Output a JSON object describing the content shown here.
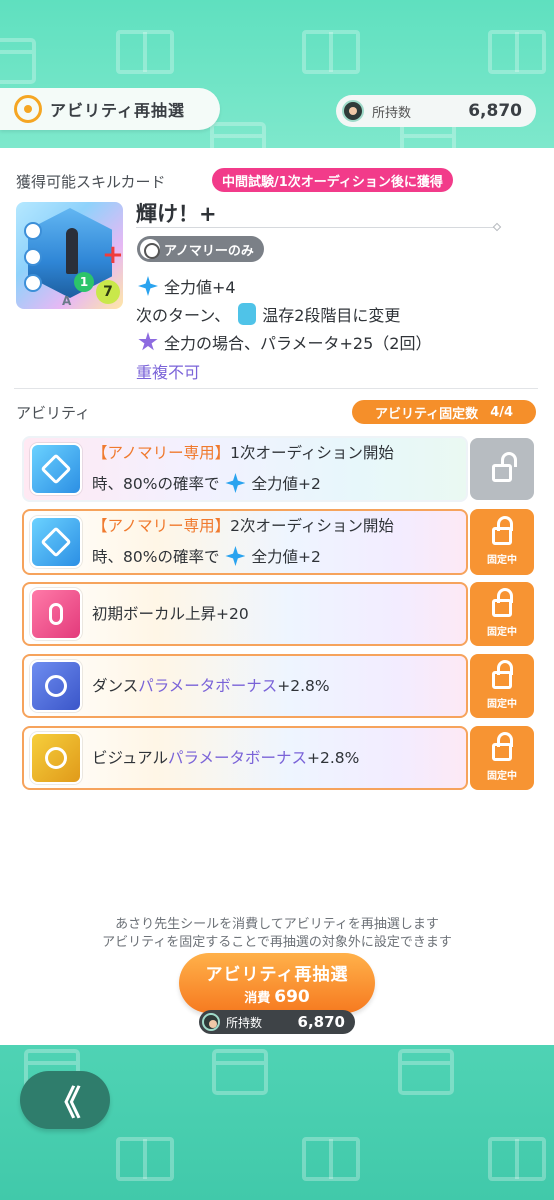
{
  "header": {
    "reroll_tab_label": "アビリティ再抽選",
    "owned_label": "所持数",
    "owned_value": "6,870"
  },
  "skill_card": {
    "section_label": "獲得可能スキルカード",
    "acquire_badge": "中間試験/1次オーディション後に獲得",
    "card_number": "1",
    "card_cost": "7",
    "card_bottom_letter": "A",
    "name": "輝け！+",
    "tag": "アノマリーのみ",
    "effects": [
      "全力値+4",
      "次のターン、",
      "温存2段階目に変更",
      "全力の場合、パラメータ+25（2回）"
    ],
    "no_duplicate": "重複不可"
  },
  "abilities": {
    "section_label": "アビリティ",
    "fixed_count_label": "アビリティ固定数",
    "fixed_count_value": "4/4",
    "lock_label": "固定中",
    "items": [
      {
        "prefix": "【アノマリー専用】",
        "line1": "1次オーディション開始",
        "line2": "時、80%の確率で",
        "effect": "全力値+2",
        "locked": false,
        "icon": "diamond-arrow-icon"
      },
      {
        "prefix": "【アノマリー専用】",
        "line1": "2次オーディション開始",
        "line2": "時、80%の確率で",
        "effect": "全力値+2",
        "locked": true,
        "icon": "diamond-arrow-icon"
      },
      {
        "text": "初期ボーカル上昇+20",
        "locked": true,
        "icon": "microphone-icon"
      },
      {
        "pre": "ダンス",
        "mid": "パラメータボーナス",
        "post": "+2.8%",
        "locked": true,
        "icon": "dance-icon"
      },
      {
        "pre": "ビジュアル",
        "mid": "パラメータボーナス",
        "post": "+2.8%",
        "locked": true,
        "icon": "visual-icon"
      }
    ]
  },
  "footer": {
    "note_line1": "あさり先生シールを消費してアビリティを再抽選します",
    "note_line2": "アビリティを固定することで再抽選の対象外に設定できます",
    "reroll_button_label": "アビリティ再抽選",
    "cost_label": "消費",
    "cost_value": "690",
    "owned_label": "所持数",
    "owned_value": "6,870",
    "back_label": "《"
  },
  "colors": {
    "accent_green": "#5fe0bf",
    "accent_orange": "#f79433",
    "badge_pink": "#f23b8a",
    "purple_text": "#7a63d8"
  }
}
